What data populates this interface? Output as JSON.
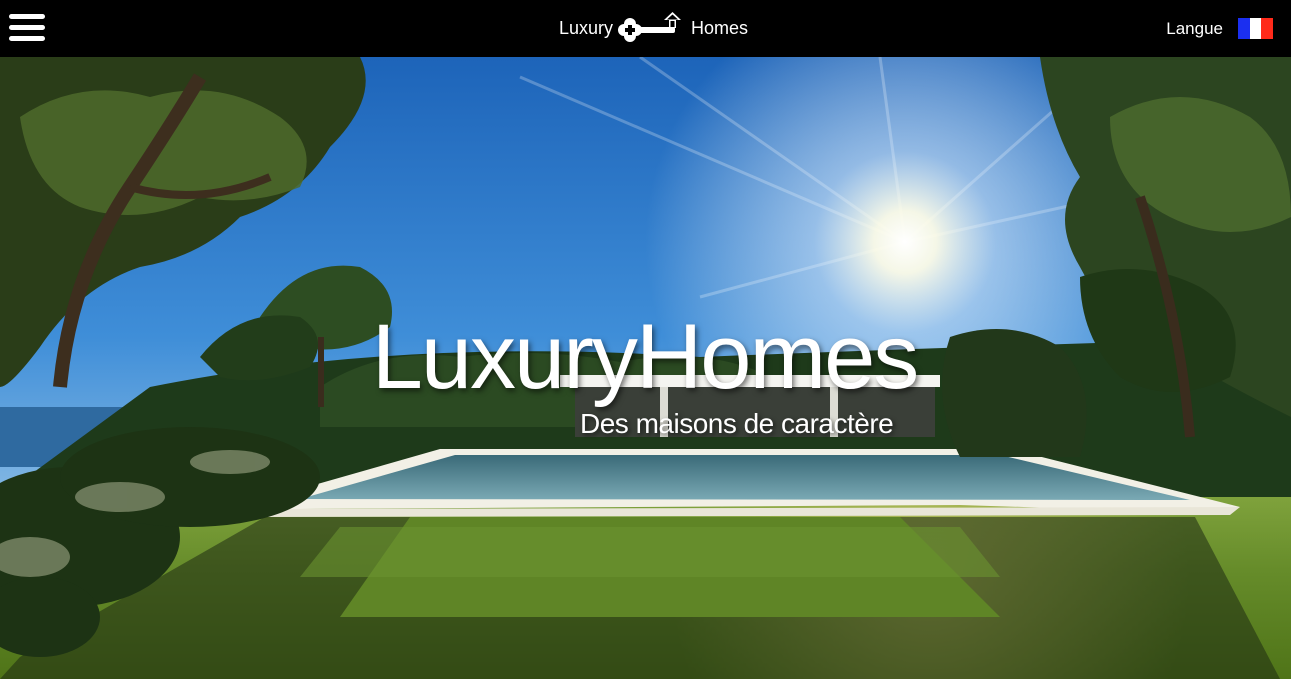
{
  "header": {
    "menu_icon": "hamburger-menu-icon",
    "logo": {
      "left_word": "Luxury",
      "right_word": "Homes",
      "icon": "key-house-icon"
    },
    "language": {
      "label": "Langue",
      "flag": "france-flag-icon",
      "flag_colors": [
        "#1b2ff0",
        "#ffffff",
        "#ff2a1a"
      ]
    }
  },
  "hero": {
    "title": "LuxuryHomes",
    "subtitle": "Des maisons de caractère",
    "image": "villa-with-pool-sunny-garden"
  },
  "colors": {
    "topbar": "#000000",
    "text": "#ffffff"
  }
}
